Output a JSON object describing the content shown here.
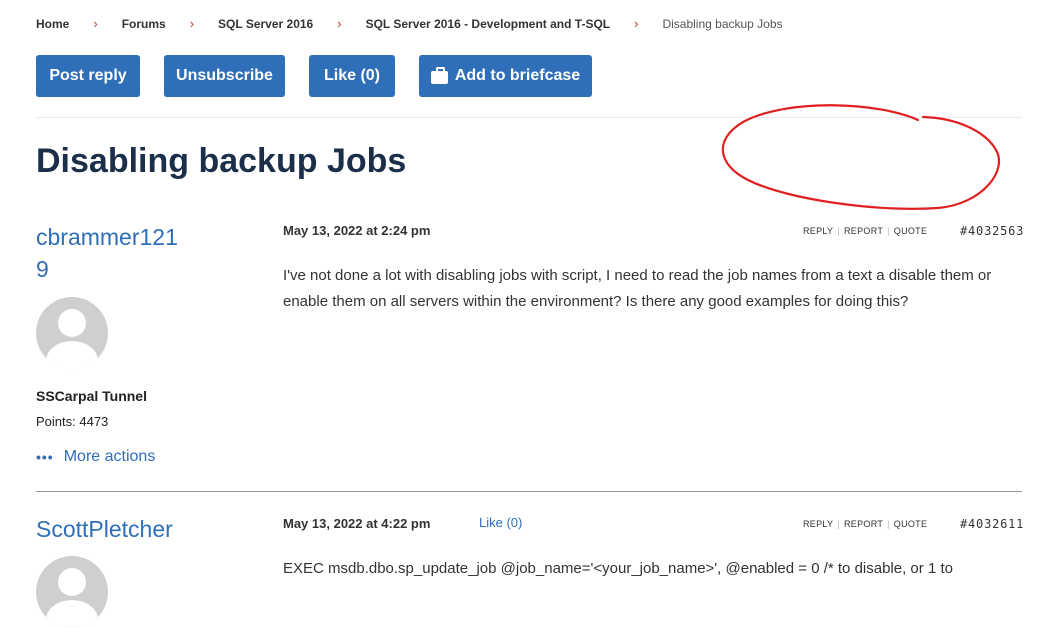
{
  "breadcrumb": {
    "items": [
      "Home",
      "Forums",
      "SQL Server 2016",
      "SQL Server 2016 - Development and T-SQL"
    ],
    "current": "Disabling backup Jobs",
    "separator": "›"
  },
  "toolbar": {
    "post_reply": "Post reply",
    "unsubscribe": "Unsubscribe",
    "like": "Like (0)",
    "add_briefcase": "Add to briefcase"
  },
  "page_title": "Disabling backup Jobs",
  "post_actions": {
    "reply": "REPLY",
    "report": "REPORT",
    "quote": "QUOTE"
  },
  "posts": [
    {
      "username_line1": "cbrammer121",
      "username_line2": "9",
      "rank": "SSCarpal Tunnel",
      "points": "Points: 4473",
      "more_actions": "More actions",
      "date": "May 13, 2022 at 2:24 pm",
      "id": "#4032563",
      "body": "I've not done a lot with disabling jobs with script, I need to read the job names from a text a disable them or enable them on all servers within the environment? Is there any good examples for doing this?"
    },
    {
      "username": "ScottPletcher",
      "date": "May 13, 2022 at 4:22 pm",
      "like": "Like (0)",
      "id": "#4032611",
      "body": "EXEC msdb.dbo.sp_update_job @job_name='<your_job_name>', @enabled = 0 /* to disable, or 1 to"
    }
  ],
  "colors": {
    "accent": "#2f6fb8",
    "title": "#1b2f4a",
    "annotation": "#e02020"
  }
}
